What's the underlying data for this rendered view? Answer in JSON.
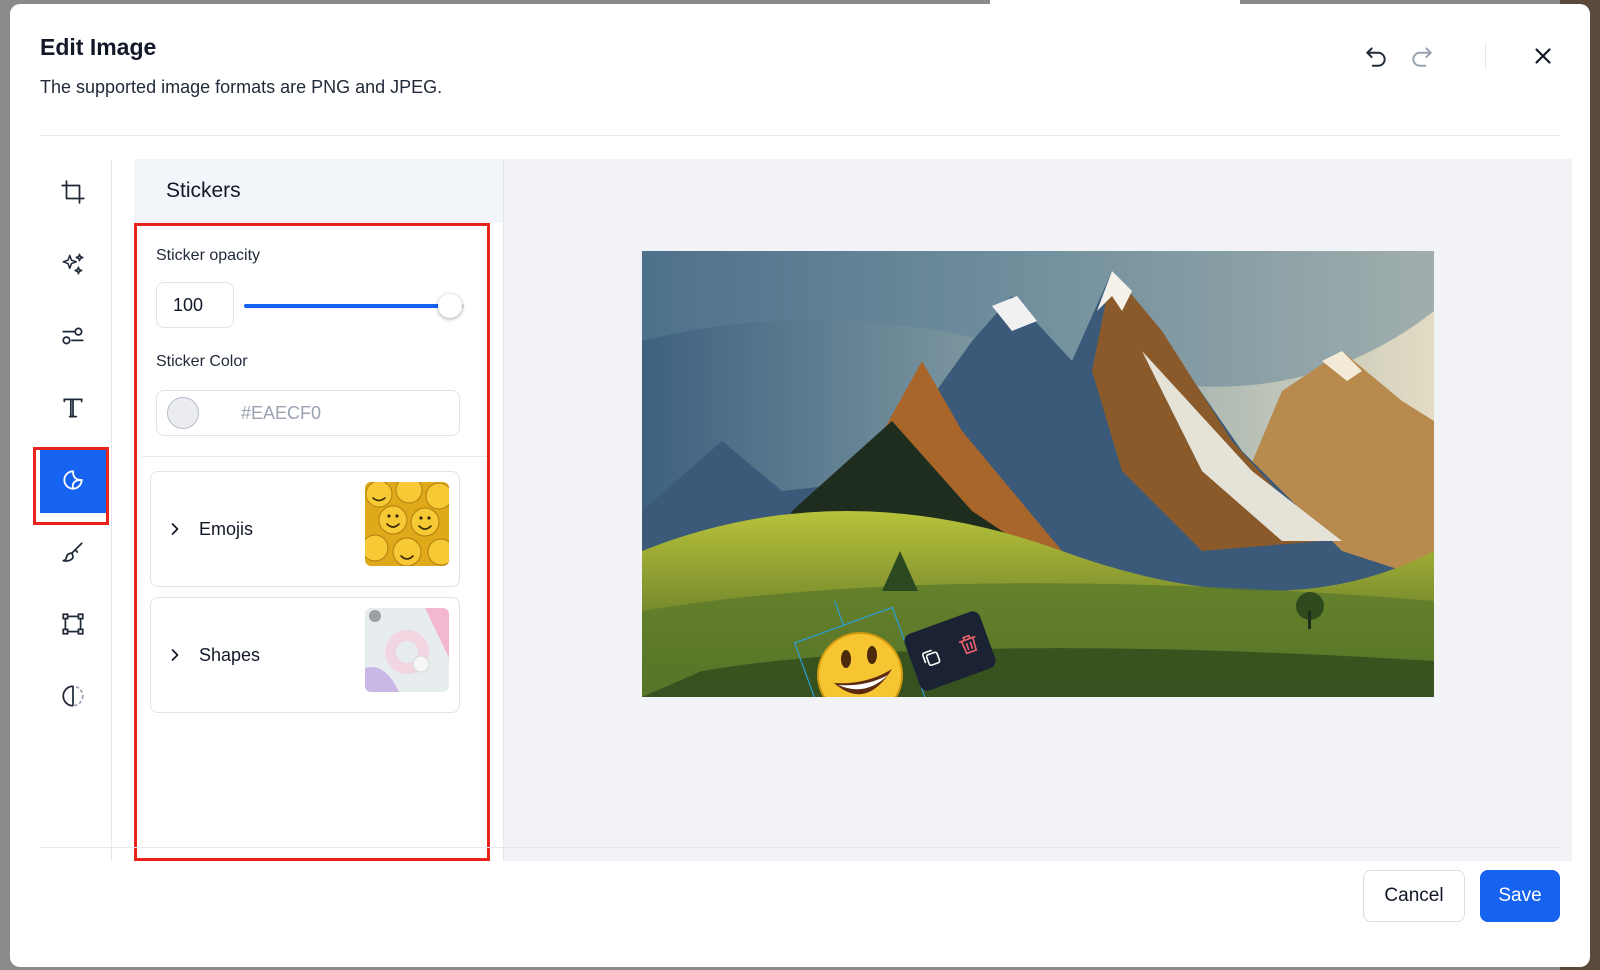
{
  "dialog": {
    "title": "Edit Image",
    "subtitle": "The supported image formats are PNG and JPEG."
  },
  "header_actions": {
    "undo_icon": "undo-icon",
    "redo_icon": "redo-icon",
    "close_icon": "close-icon"
  },
  "tools": [
    {
      "name": "crop",
      "icon": "crop-icon"
    },
    {
      "name": "filters",
      "icon": "sparkles-icon"
    },
    {
      "name": "adjust",
      "icon": "sliders-icon"
    },
    {
      "name": "text",
      "icon": "text-icon"
    },
    {
      "name": "stickers",
      "icon": "sticker-icon",
      "active": true
    },
    {
      "name": "draw",
      "icon": "brush-icon"
    },
    {
      "name": "resize",
      "icon": "frame-icon"
    },
    {
      "name": "contrast",
      "icon": "contrast-icon"
    }
  ],
  "panel": {
    "title": "Stickers",
    "opacity_label": "Sticker opacity",
    "opacity_value": "100",
    "opacity_fraction": 1.0,
    "color_label": "Sticker Color",
    "color_value": "#EAECF0",
    "categories": [
      {
        "label": "Emojis"
      },
      {
        "label": "Shapes"
      }
    ]
  },
  "colors": {
    "accent": "#1663f2",
    "highlight": "#e8231b",
    "swatch": "#EAECF0"
  },
  "footer": {
    "cancel_label": "Cancel",
    "save_label": "Save"
  }
}
